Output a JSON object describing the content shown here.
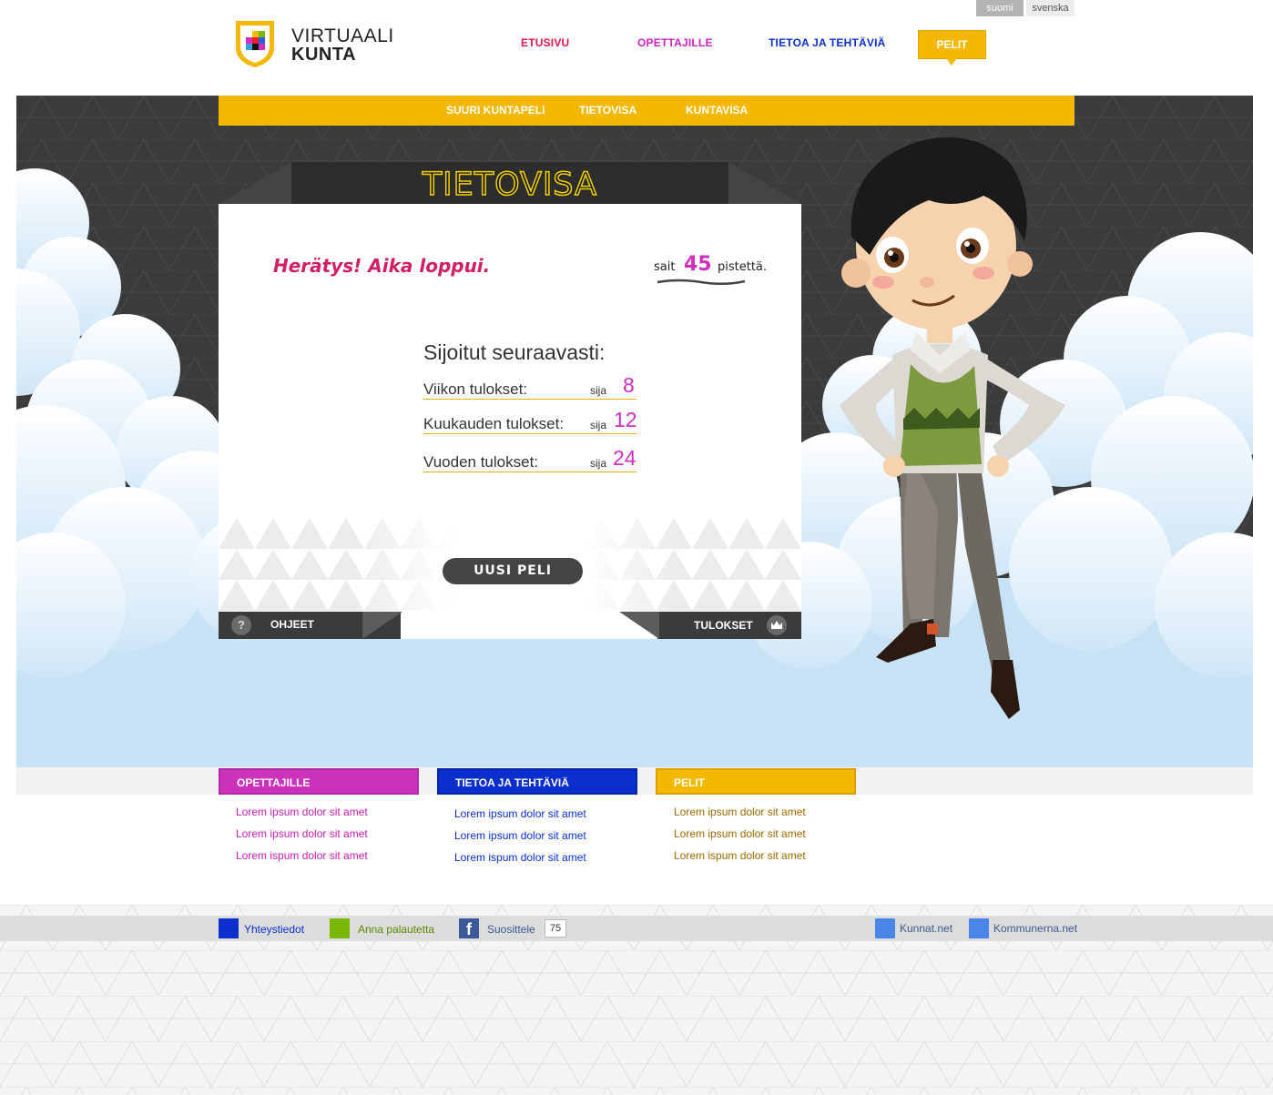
{
  "lang": {
    "fi": "suomi",
    "sv": "svenska"
  },
  "logo": {
    "line1": "VIRTUAALI",
    "line2": "KUNTA"
  },
  "nav": {
    "etusivu": "ETUSIVU",
    "opettajille": "OPETTAJILLE",
    "tietoa": "TIETOA JA TEHTÄVIÄ",
    "pelit": "PELIT"
  },
  "subnav": {
    "items": [
      "SUURI KUNTAPELI",
      "TIETOVISA",
      "KUNTAVISA"
    ]
  },
  "game": {
    "title": "TIETOVISA",
    "alarm": "Herätys! Aika loppui.",
    "score_prefix": "sait",
    "score": "45",
    "score_suffix": "pistettä.",
    "rank_heading": "Sijoitut seuraavasti:",
    "rows": [
      {
        "label": "Viikon tulokset:",
        "sija": "sija",
        "rank": "8"
      },
      {
        "label": "Kuukauden tulokset:",
        "sija": "sija",
        "rank": "12"
      },
      {
        "label": "Vuoden tulokset:",
        "sija": "sija",
        "rank": "24"
      }
    ],
    "new_game": "UUSI PELI",
    "help_icon": "?",
    "help": "OHJEET",
    "results": "TULOKSET"
  },
  "footer_cols": [
    {
      "title": "OPETTAJILLE",
      "color": "#cc33bb",
      "link_color": "#c020b0",
      "links": [
        "Lorem ipsum dolor sit amet",
        "Lorem ipsum dolor sit amet",
        "Lorem ispum dolor sit amet"
      ]
    },
    {
      "title": "TIETOA JA TEHTÄVIÄ",
      "color": "#0a2fcc",
      "link_color": "#0a2fcc",
      "links": [
        "Lorem ipsum dolor sit amet",
        "Lorem ipsum dolor sit amet",
        "Lorem ispum dolor sit amet"
      ]
    },
    {
      "title": "PELIT",
      "color": "#f5b800",
      "link_color": "#9a6a00",
      "links": [
        "Lorem ipsum dolor sit amet",
        "Lorem ipsum dolor sit amet",
        "Lorem ispum dolor sit amet"
      ]
    }
  ],
  "bottom": {
    "yhteystiedot": "Yhteystiedot",
    "palaute": "Anna palautetta",
    "fb_icon": "f",
    "suosittele": "Suosittele",
    "suosittele_count": "75",
    "kunnat": "Kunnat.net",
    "kommunerna": "Kommunerna.net"
  },
  "colors": {
    "accent": "#f5b800",
    "magenta": "#d12ec0",
    "blue": "#0a2fcc",
    "green": "#7ab800",
    "dark": "#3b3b3b",
    "sky": "#c7e2f5"
  }
}
